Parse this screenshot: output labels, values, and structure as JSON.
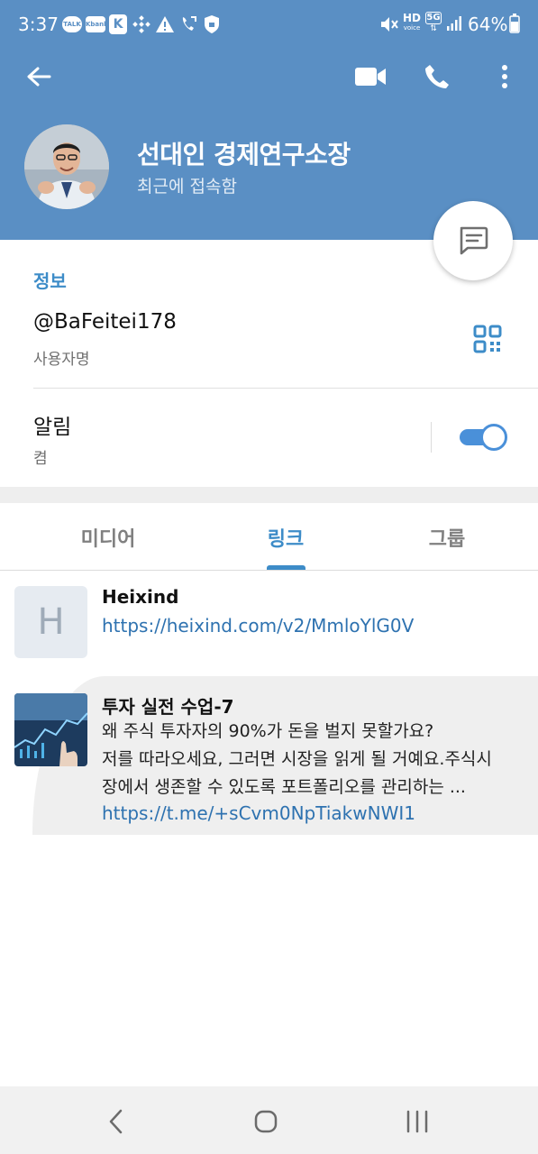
{
  "status_bar": {
    "time": "3:37",
    "left_icons": [
      "talk-icon",
      "kbank-icon",
      "k-app-icon",
      "binance-icon",
      "warning-icon",
      "call-forward-icon",
      "shield-icon"
    ],
    "talk_badge": "TALK",
    "kbank_badge": "Kbank",
    "k_badge": "K",
    "hd_label": "HD",
    "hd_sub": "voice",
    "net_label": "5G",
    "battery": "64%"
  },
  "header": {
    "name": "선대인 경제연구소장",
    "status": "최근에 접속함",
    "bg_color": "#5a8fc4"
  },
  "info": {
    "section_title": "정보",
    "username": "@BaFeitei178",
    "username_label": "사용자명",
    "notifications_title": "알림",
    "notifications_value": "켬",
    "notifications_on": true
  },
  "tabs": {
    "items": [
      "미디어",
      "링크",
      "그룹"
    ],
    "active": "링크"
  },
  "links": [
    {
      "thumb_letter": "H",
      "title": "Heixind",
      "url": "https://heixind.com/v2/MmloYlG0V"
    },
    {
      "title": "투자 실전 수업-7",
      "description": [
        "왜 주식 투자자의 90%가 돈을 벌지 못할가요?",
        "저를 따라오세요, 그러면 시장을 읽게 될 거예요.주식시",
        "장에서 생존할 수 있도록 포트폴리오를 관리하는 ..."
      ],
      "url": "https://t.me/+sCvm0NpTiakwNWI1"
    }
  ],
  "accent_color": "#3d8cc8"
}
